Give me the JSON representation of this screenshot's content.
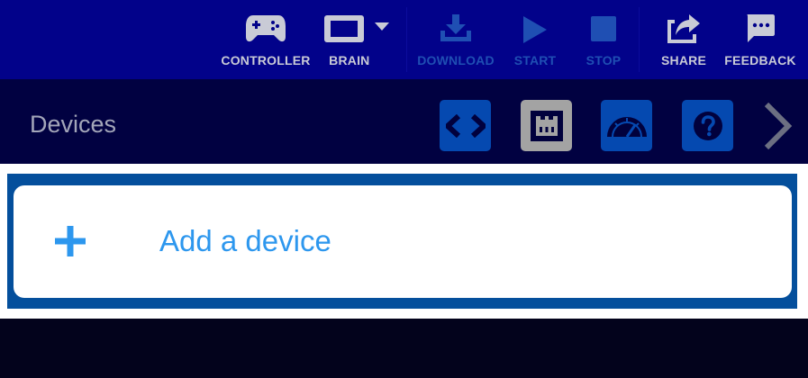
{
  "toolbar": {
    "controller_label": "CONTROLLER",
    "brain_label": "BRAIN",
    "download_label": "DOWNLOAD",
    "start_label": "START",
    "stop_label": "STOP",
    "share_label": "SHARE",
    "feedback_label": "FEEDBACK",
    "active_color": "#c9cbd6",
    "disabled_color": "#1f4fb3"
  },
  "devices_panel": {
    "title": "Devices",
    "tabs": [
      "code-view",
      "devices",
      "dashboard",
      "help"
    ],
    "selected_tab": "devices",
    "add_device_label": "Add a device"
  },
  "colors": {
    "topbar": "#02028a",
    "subbar": "#010141",
    "tab_active": "#a3a3a3",
    "tab_inactive": "#0549b0",
    "accent": "#2d97ee"
  }
}
